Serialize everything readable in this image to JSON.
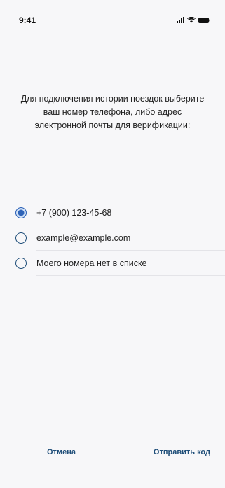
{
  "status_bar": {
    "time": "9:41",
    "icons": [
      "signal-icon",
      "wifi-icon",
      "battery-icon"
    ]
  },
  "prompt": {
    "text": "Для подключения истории поездок выберите ваш номер телефона, либо адрес электронной почты для верификации:"
  },
  "options": [
    {
      "label": "+7 (900) 123-45-68",
      "selected": true
    },
    {
      "label": "example@example.com",
      "selected": false
    },
    {
      "label": "Моего номера нет в списке",
      "selected": false
    }
  ],
  "actions": {
    "cancel_label": "Отмена",
    "send_label": "Отправить код"
  },
  "colors": {
    "accent": "#2e63b8",
    "link": "#1f4e79",
    "background": "#f7f7f9"
  }
}
